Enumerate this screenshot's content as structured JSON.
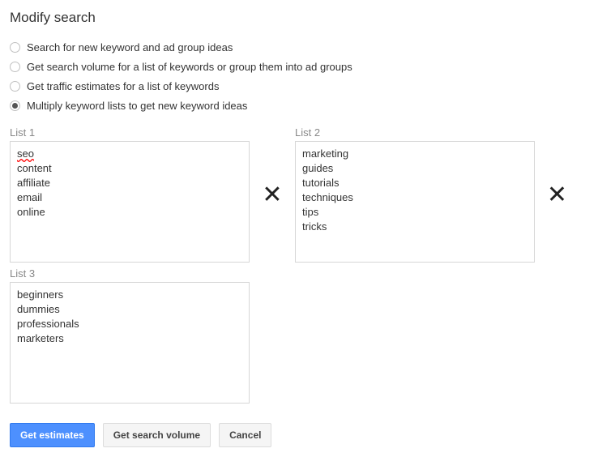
{
  "title": "Modify search",
  "options": [
    {
      "label": "Search for new keyword and ad group ideas",
      "selected": false
    },
    {
      "label": "Get search volume for a list of keywords or group them into ad groups",
      "selected": false
    },
    {
      "label": "Get traffic estimates for a list of keywords",
      "selected": false
    },
    {
      "label": "Multiply keyword lists to get new keyword ideas",
      "selected": true
    }
  ],
  "lists": {
    "list1": {
      "label": "List 1",
      "items": [
        "seo",
        "content",
        "affiliate",
        "email",
        "online"
      ]
    },
    "list2": {
      "label": "List 2",
      "items": [
        "marketing",
        "guides",
        "tutorials",
        "techniques",
        "tips",
        "tricks"
      ]
    },
    "list3": {
      "label": "List 3",
      "items": [
        "beginners",
        "dummies",
        "professionals",
        "marketers"
      ]
    }
  },
  "multiply_glyph": "✕",
  "buttons": {
    "estimates": "Get estimates",
    "volume": "Get search volume",
    "cancel": "Cancel"
  }
}
